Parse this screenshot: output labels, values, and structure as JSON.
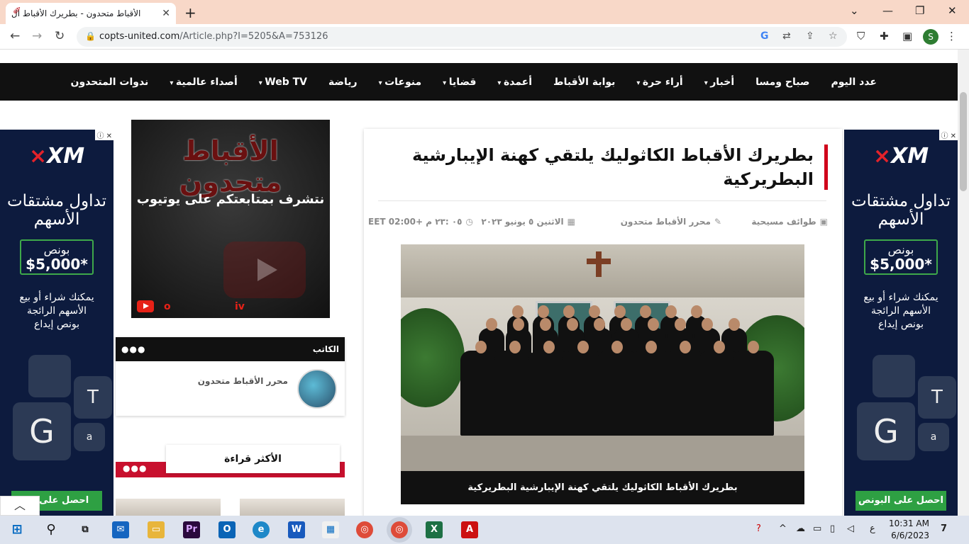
{
  "browser": {
    "tab_title": "الأقباط متحدون - بطريرك الأقباط ال",
    "url_host": "copts-united.com",
    "url_path": "/Article.php?I=5205&A=753126",
    "profile_initial": "S"
  },
  "nav": {
    "items": [
      {
        "label": "عدد اليوم",
        "dropdown": false
      },
      {
        "label": "صباح ومسا",
        "dropdown": false
      },
      {
        "label": "أخبار",
        "dropdown": true
      },
      {
        "label": "أراء حرة",
        "dropdown": true
      },
      {
        "label": "بوابة الأقباط",
        "dropdown": false
      },
      {
        "label": "أعمدة",
        "dropdown": true
      },
      {
        "label": "قضايا",
        "dropdown": true
      },
      {
        "label": "منوعات",
        "dropdown": true
      },
      {
        "label": "رياضة",
        "dropdown": false
      },
      {
        "label": "Web TV",
        "dropdown": true
      },
      {
        "label": "أصداء عالمية",
        "dropdown": true
      },
      {
        "label": "ندوات المتحدون",
        "dropdown": false
      }
    ]
  },
  "ad": {
    "brand": "XM",
    "headline": "تداول مشتقات الأسهم",
    "bonus_label": "بونص",
    "bonus_amount": "$5,000*",
    "sub_line1": "يمكنك شراء أو بيع",
    "sub_line2": "الأسهم الرائجة",
    "sub_line3": "بونص إيداع",
    "cta": "احصل على البونص",
    "cta_left": "احصل على ال"
  },
  "video": {
    "title": "الأقباط متحدون",
    "subtitle": "نتشرف بمتابعتكم على يوتيوب",
    "caption_left": "o",
    "caption_right": "iv"
  },
  "writer": {
    "label": "الكاتب",
    "dots": "●●●",
    "name": "محرر الأقباط متحدون"
  },
  "most_read": {
    "label": "الأكثر قراءة",
    "dots": "●●●"
  },
  "article": {
    "title": "بطريرك الأقباط الكاثوليك يلتقي كهنة الإيبارشية البطريركية",
    "category": "طوائف مسيحية",
    "author": "محرر الأقباط متحدون",
    "date": "الاثنين ٥ يونيو ٢٠٢٣",
    "time": "٠٥ :٢٣ م +02:00 EET",
    "caption": "بطريرك الأقباط الكاثوليك يلتقي كهنة الإيبارشية البطريركية"
  },
  "taskbar": {
    "time": "10:31 AM",
    "date": "6/6/2023",
    "lang": "ع",
    "notifications": "7"
  },
  "colors": {
    "nav_bg": "#111111",
    "accent_red": "#d0021b",
    "ad_bg": "#0d1b3e",
    "ad_green": "#2ea043",
    "tab_strip": "#f8d8c8"
  }
}
